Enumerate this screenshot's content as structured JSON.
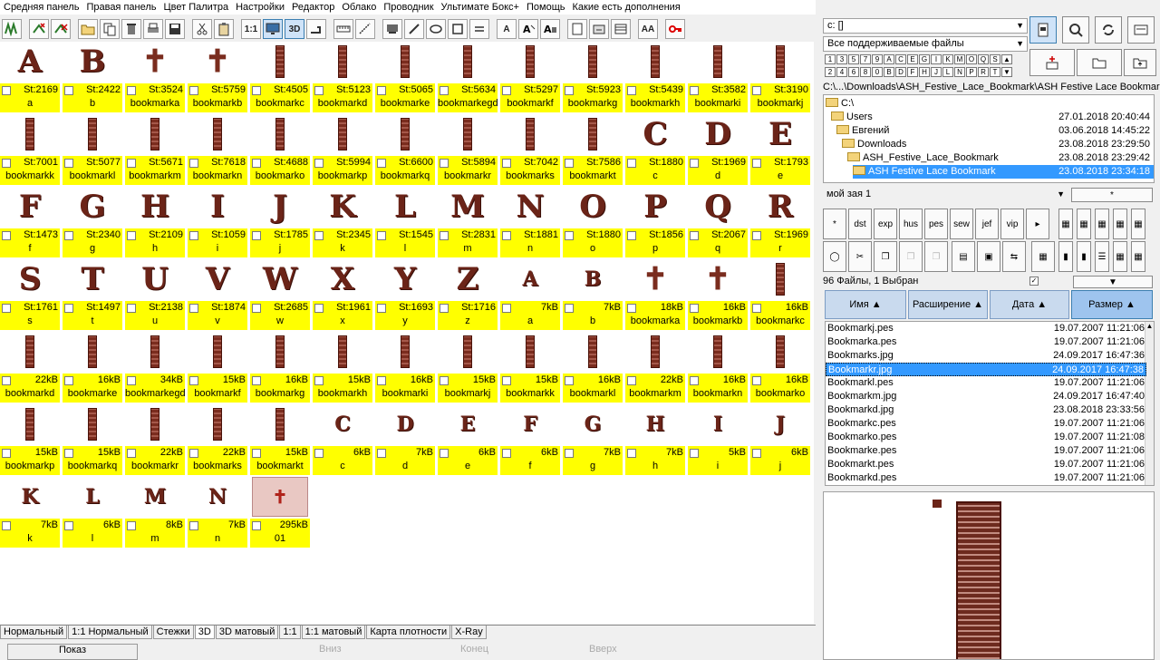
{
  "menu": [
    "Средняя панель",
    "Правая панель",
    "Цвет Палитра",
    "Настройки",
    "Редактор",
    "Облако",
    "Проводник",
    "Ультимате Бокс+",
    "Помощь",
    "Какие есть дополнения"
  ],
  "toolbar": {
    "one_to_one": "1:1",
    "three_d": "3D",
    "text_a": "A",
    "aa": "AA"
  },
  "grid": [
    {
      "thumb": "glyph",
      "g": "A",
      "size": "St:2169",
      "name": "a"
    },
    {
      "thumb": "glyph",
      "g": "B",
      "size": "St:2422",
      "name": "b"
    },
    {
      "thumb": "cross",
      "g": "✝",
      "size": "St:3524",
      "name": "bookmarka"
    },
    {
      "thumb": "cross",
      "g": "✝",
      "size": "St:5759",
      "name": "bookmarkb"
    },
    {
      "thumb": "bar",
      "g": "",
      "size": "St:4505",
      "name": "bookmarkc"
    },
    {
      "thumb": "bar",
      "g": "",
      "size": "St:5123",
      "name": "bookmarkd"
    },
    {
      "thumb": "bar",
      "g": "",
      "size": "St:5065",
      "name": "bookmarke"
    },
    {
      "thumb": "bar",
      "g": "",
      "size": "St:5634",
      "name": "bookmarkegd"
    },
    {
      "thumb": "bar",
      "g": "",
      "size": "St:5297",
      "name": "bookmarkf"
    },
    {
      "thumb": "bar",
      "g": "",
      "size": "St:5923",
      "name": "bookmarkg"
    },
    {
      "thumb": "bar",
      "g": "",
      "size": "St:5439",
      "name": "bookmarkh"
    },
    {
      "thumb": "bar",
      "g": "",
      "size": "St:3582",
      "name": "bookmarki"
    },
    {
      "thumb": "bar",
      "g": "",
      "size": "St:3190",
      "name": "bookmarkj"
    },
    {
      "thumb": "bar",
      "g": "",
      "size": "St:7001",
      "name": "bookmarkk"
    },
    {
      "thumb": "bar",
      "g": "",
      "size": "St:5077",
      "name": "bookmarkl"
    },
    {
      "thumb": "bar",
      "g": "",
      "size": "St:5671",
      "name": "bookmarkm"
    },
    {
      "thumb": "bar",
      "g": "",
      "size": "St:7618",
      "name": "bookmarkn"
    },
    {
      "thumb": "bar",
      "g": "",
      "size": "St:4688",
      "name": "bookmarko"
    },
    {
      "thumb": "bar",
      "g": "",
      "size": "St:5994",
      "name": "bookmarkp"
    },
    {
      "thumb": "bar",
      "g": "",
      "size": "St:6600",
      "name": "bookmarkq"
    },
    {
      "thumb": "bar",
      "g": "",
      "size": "St:5894",
      "name": "bookmarkr"
    },
    {
      "thumb": "bar",
      "g": "",
      "size": "St:7042",
      "name": "bookmarks"
    },
    {
      "thumb": "bar",
      "g": "",
      "size": "St:7586",
      "name": "bookmarkt"
    },
    {
      "thumb": "glyph",
      "g": "C",
      "size": "St:1880",
      "name": "c"
    },
    {
      "thumb": "glyph",
      "g": "D",
      "size": "St:1969",
      "name": "d"
    },
    {
      "thumb": "glyph",
      "g": "E",
      "size": "St:1793",
      "name": "e"
    },
    {
      "thumb": "glyph",
      "g": "F",
      "size": "St:1473",
      "name": "f"
    },
    {
      "thumb": "glyph",
      "g": "G",
      "size": "St:2340",
      "name": "g"
    },
    {
      "thumb": "glyph",
      "g": "H",
      "size": "St:2109",
      "name": "h"
    },
    {
      "thumb": "glyph",
      "g": "I",
      "size": "St:1059",
      "name": "i"
    },
    {
      "thumb": "glyph",
      "g": "J",
      "size": "St:1785",
      "name": "j"
    },
    {
      "thumb": "glyph",
      "g": "K",
      "size": "St:2345",
      "name": "k"
    },
    {
      "thumb": "glyph",
      "g": "L",
      "size": "St:1545",
      "name": "l"
    },
    {
      "thumb": "glyph",
      "g": "M",
      "size": "St:2831",
      "name": "m"
    },
    {
      "thumb": "glyph",
      "g": "N",
      "size": "St:1881",
      "name": "n"
    },
    {
      "thumb": "glyph",
      "g": "O",
      "size": "St:1880",
      "name": "o"
    },
    {
      "thumb": "glyph",
      "g": "P",
      "size": "St:1856",
      "name": "p"
    },
    {
      "thumb": "glyph",
      "g": "Q",
      "size": "St:2067",
      "name": "q"
    },
    {
      "thumb": "glyph",
      "g": "R",
      "size": "St:1969",
      "name": "r"
    },
    {
      "thumb": "glyph",
      "g": "S",
      "size": "St:1761",
      "name": "s"
    },
    {
      "thumb": "glyph",
      "g": "T",
      "size": "St:1497",
      "name": "t"
    },
    {
      "thumb": "glyph",
      "g": "U",
      "size": "St:2138",
      "name": "u"
    },
    {
      "thumb": "glyph",
      "g": "V",
      "size": "St:1874",
      "name": "v"
    },
    {
      "thumb": "glyph",
      "g": "W",
      "size": "St:2685",
      "name": "w"
    },
    {
      "thumb": "glyph",
      "g": "X",
      "size": "St:1961",
      "name": "x"
    },
    {
      "thumb": "glyph",
      "g": "Y",
      "size": "St:1693",
      "name": "y"
    },
    {
      "thumb": "glyph",
      "g": "Z",
      "size": "St:1716",
      "name": "z"
    },
    {
      "thumb": "small",
      "g": "A",
      "size": "7kB",
      "name": "a"
    },
    {
      "thumb": "small",
      "g": "B",
      "size": "7kB",
      "name": "b"
    },
    {
      "thumb": "cross",
      "g": "✝",
      "size": "18kB",
      "name": "bookmarka"
    },
    {
      "thumb": "cross",
      "g": "✝",
      "size": "16kB",
      "name": "bookmarkb"
    },
    {
      "thumb": "bar",
      "g": "",
      "size": "16kB",
      "name": "bookmarkc"
    },
    {
      "thumb": "bar",
      "g": "",
      "size": "22kB",
      "name": "bookmarkd"
    },
    {
      "thumb": "bar",
      "g": "",
      "size": "16kB",
      "name": "bookmarke"
    },
    {
      "thumb": "bar",
      "g": "",
      "size": "34kB",
      "name": "bookmarkegd"
    },
    {
      "thumb": "bar",
      "g": "",
      "size": "15kB",
      "name": "bookmarkf"
    },
    {
      "thumb": "bar",
      "g": "",
      "size": "16kB",
      "name": "bookmarkg"
    },
    {
      "thumb": "bar",
      "g": "",
      "size": "15kB",
      "name": "bookmarkh"
    },
    {
      "thumb": "bar",
      "g": "",
      "size": "16kB",
      "name": "bookmarki"
    },
    {
      "thumb": "bar",
      "g": "",
      "size": "15kB",
      "name": "bookmarkj"
    },
    {
      "thumb": "bar",
      "g": "",
      "size": "15kB",
      "name": "bookmarkk"
    },
    {
      "thumb": "bar",
      "g": "",
      "size": "16kB",
      "name": "bookmarkl"
    },
    {
      "thumb": "bar",
      "g": "",
      "size": "22kB",
      "name": "bookmarkm"
    },
    {
      "thumb": "bar",
      "g": "",
      "size": "16kB",
      "name": "bookmarkn"
    },
    {
      "thumb": "bar",
      "g": "",
      "size": "16kB",
      "name": "bookmarko"
    },
    {
      "thumb": "bar",
      "g": "",
      "size": "15kB",
      "name": "bookmarkp"
    },
    {
      "thumb": "bar",
      "g": "",
      "size": "15kB",
      "name": "bookmarkq"
    },
    {
      "thumb": "bar",
      "g": "",
      "size": "22kB",
      "name": "bookmarkr"
    },
    {
      "thumb": "bar",
      "g": "",
      "size": "22kB",
      "name": "bookmarks"
    },
    {
      "thumb": "bar",
      "g": "",
      "size": "15kB",
      "name": "bookmarkt"
    },
    {
      "thumb": "small",
      "g": "C",
      "size": "6kB",
      "name": "c"
    },
    {
      "thumb": "small",
      "g": "D",
      "size": "7kB",
      "name": "d"
    },
    {
      "thumb": "small",
      "g": "E",
      "size": "6kB",
      "name": "e"
    },
    {
      "thumb": "small",
      "g": "F",
      "size": "6kB",
      "name": "f"
    },
    {
      "thumb": "small",
      "g": "G",
      "size": "7kB",
      "name": "g"
    },
    {
      "thumb": "small",
      "g": "H",
      "size": "7kB",
      "name": "h"
    },
    {
      "thumb": "small",
      "g": "I",
      "size": "5kB",
      "name": "i"
    },
    {
      "thumb": "small",
      "g": "J",
      "size": "6kB",
      "name": "j"
    },
    {
      "thumb": "small",
      "g": "K",
      "size": "7kB",
      "name": "k"
    },
    {
      "thumb": "small",
      "g": "L",
      "size": "6kB",
      "name": "l"
    },
    {
      "thumb": "small",
      "g": "M",
      "size": "8kB",
      "name": "m"
    },
    {
      "thumb": "small",
      "g": "N",
      "size": "7kB",
      "name": "n"
    },
    {
      "thumb": "photo",
      "g": "✝",
      "size": "295kB",
      "name": "01"
    }
  ],
  "view_tabs": [
    "Нормальный",
    "1:1 Нормальный",
    "Стежки",
    "3D",
    "3D матовый",
    "1:1",
    "1:1 матовый",
    "Карта плотности",
    "X-Ray"
  ],
  "bottom": {
    "b1": "Показ",
    "b2": "Вниз",
    "b3": "Конец",
    "b4": "Вверх"
  },
  "drive": "c: []",
  "filter": "Все поддерживаемые файлы",
  "keys_row1": [
    "1",
    "3",
    "5",
    "7",
    "9",
    "A",
    "C",
    "E",
    "G",
    "I",
    "K",
    "M",
    "O",
    "Q",
    "S"
  ],
  "keys_row2": [
    "2",
    "4",
    "6",
    "8",
    "0",
    "B",
    "D",
    "F",
    "H",
    "J",
    "L",
    "N",
    "P",
    "R",
    "T"
  ],
  "path": "C:\\...\\Downloads\\ASH_Festive_Lace_Bookmark\\ASH Festive Lace Bookmark",
  "tree": [
    {
      "label": "C:\\",
      "date": ""
    },
    {
      "label": "Users",
      "date": "27.01.2018 20:40:44"
    },
    {
      "label": "Евгений",
      "date": "03.06.2018 14:45:22"
    },
    {
      "label": "Downloads",
      "date": "23.08.2018 23:29:50"
    },
    {
      "label": "ASH_Festive_Lace_Bookmark",
      "date": "23.08.2018 23:29:42"
    },
    {
      "label": "ASH Festive Lace Bookmark",
      "date": "23.08.2018 23:34:18"
    }
  ],
  "set_name": "мой зая 1",
  "set_btn": "*",
  "format_btns": [
    "*",
    "dst",
    "exp",
    "hus",
    "pes",
    "sew",
    "jef",
    "vip",
    "▸"
  ],
  "status": "96 Файлы, 1 Выбран",
  "columns": [
    "Имя ▲",
    "Расширение ▲",
    "Дата ▲",
    "Размер ▲"
  ],
  "files": [
    {
      "name": "Bookmarkj.pes",
      "date": "19.07.2007 11:21:06"
    },
    {
      "name": "Bookmarka.pes",
      "date": "19.07.2007 11:21:06"
    },
    {
      "name": "Bookmarks.jpg",
      "date": "24.09.2017 16:47:36"
    },
    {
      "name": "Bookmarkr.jpg",
      "date": "24.09.2017 16:47:38"
    },
    {
      "name": "Bookmarkl.pes",
      "date": "19.07.2007 11:21:06"
    },
    {
      "name": "Bookmarkm.jpg",
      "date": "24.09.2017 16:47:40"
    },
    {
      "name": "Bookmarkd.jpg",
      "date": "23.08.2018 23:33:56"
    },
    {
      "name": "Bookmarkc.pes",
      "date": "19.07.2007 11:21:06"
    },
    {
      "name": "Bookmarko.pes",
      "date": "19.07.2007 11:21:08"
    },
    {
      "name": "Bookmarke.pes",
      "date": "19.07.2007 11:21:06"
    },
    {
      "name": "Bookmarkt.pes",
      "date": "19.07.2007 11:21:06"
    },
    {
      "name": "Bookmarkd.pes",
      "date": "19.07.2007 11:21:06"
    }
  ],
  "colors": {
    "highlight": "#ffff00",
    "select": "#3399ff",
    "thread": "#6b2418"
  }
}
